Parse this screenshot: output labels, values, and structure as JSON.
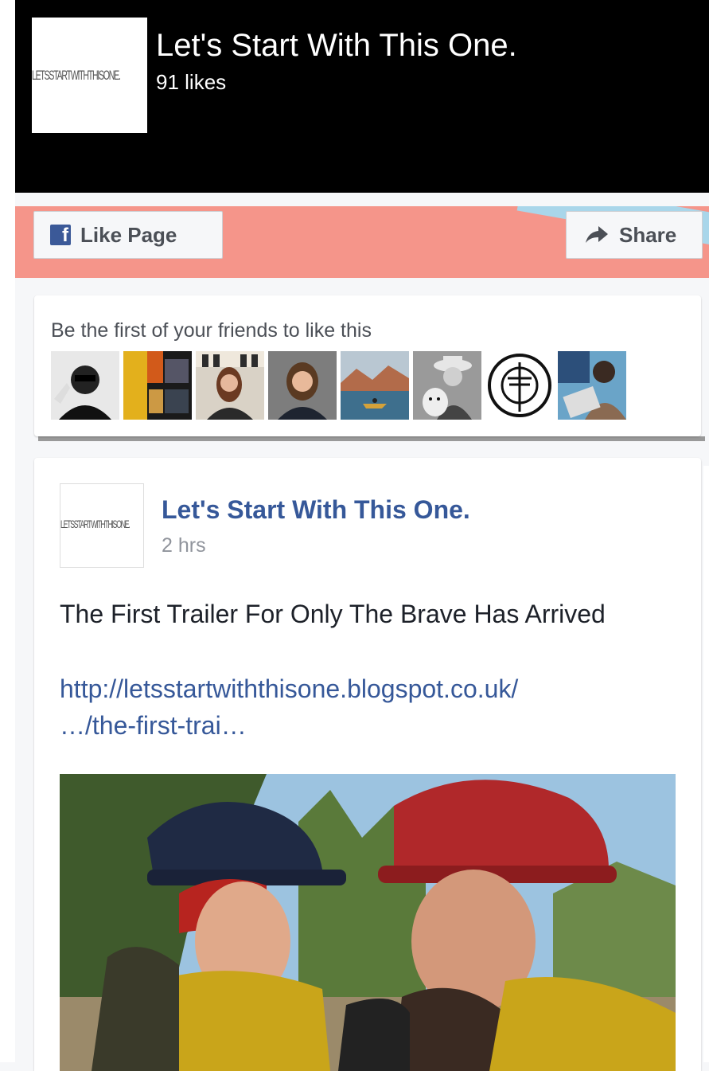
{
  "header": {
    "page_title": "Let's Start With This One.",
    "likes": "91 likes",
    "logo_text": "LETSSTARTWITHTHISONE."
  },
  "actions": {
    "like_label": "Like Page",
    "share_label": "Share"
  },
  "friends": {
    "prompt": "Be the first of your friends to like this",
    "avatars": [
      "friend-1",
      "friend-2",
      "friend-3",
      "friend-4",
      "friend-5",
      "friend-6",
      "friend-7",
      "friend-8"
    ]
  },
  "post": {
    "author": "Let's Start With This One.",
    "time": "2 hrs",
    "text": "The First Trailer For Only The Brave Has Arrived",
    "link_line1": "http://letsstartwiththisone.blogspot.co.uk/",
    "link_line2": "…/the-first-trai…"
  },
  "colors": {
    "header_bg": "#000000",
    "cover_bg": "#f5958a",
    "link": "#365899",
    "facebook_blue": "#3b5998"
  }
}
